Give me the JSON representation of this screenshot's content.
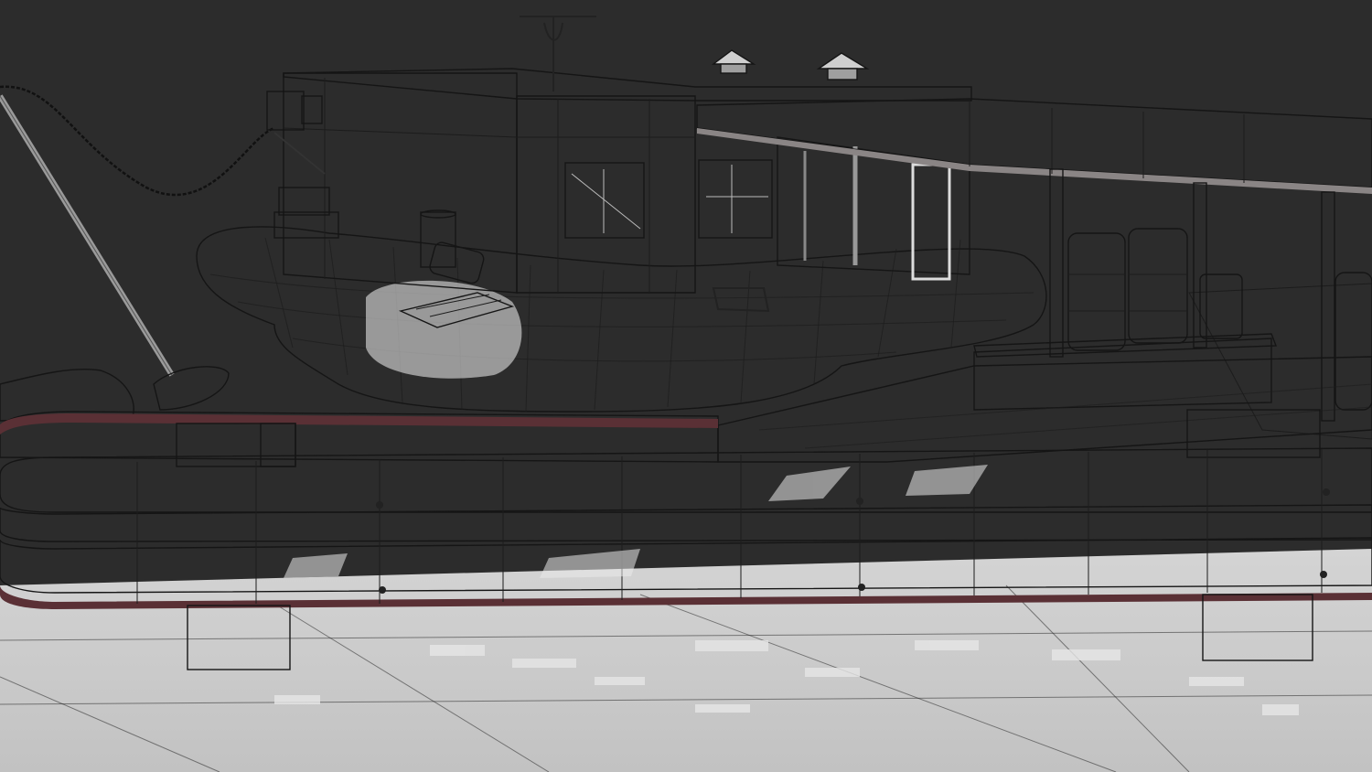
{
  "scene": {
    "background_color": "#2c2c2c",
    "shading": "solid-wireframe",
    "surface_color": "#cfcfcf",
    "rail_stripe_color": "#5a3035"
  }
}
